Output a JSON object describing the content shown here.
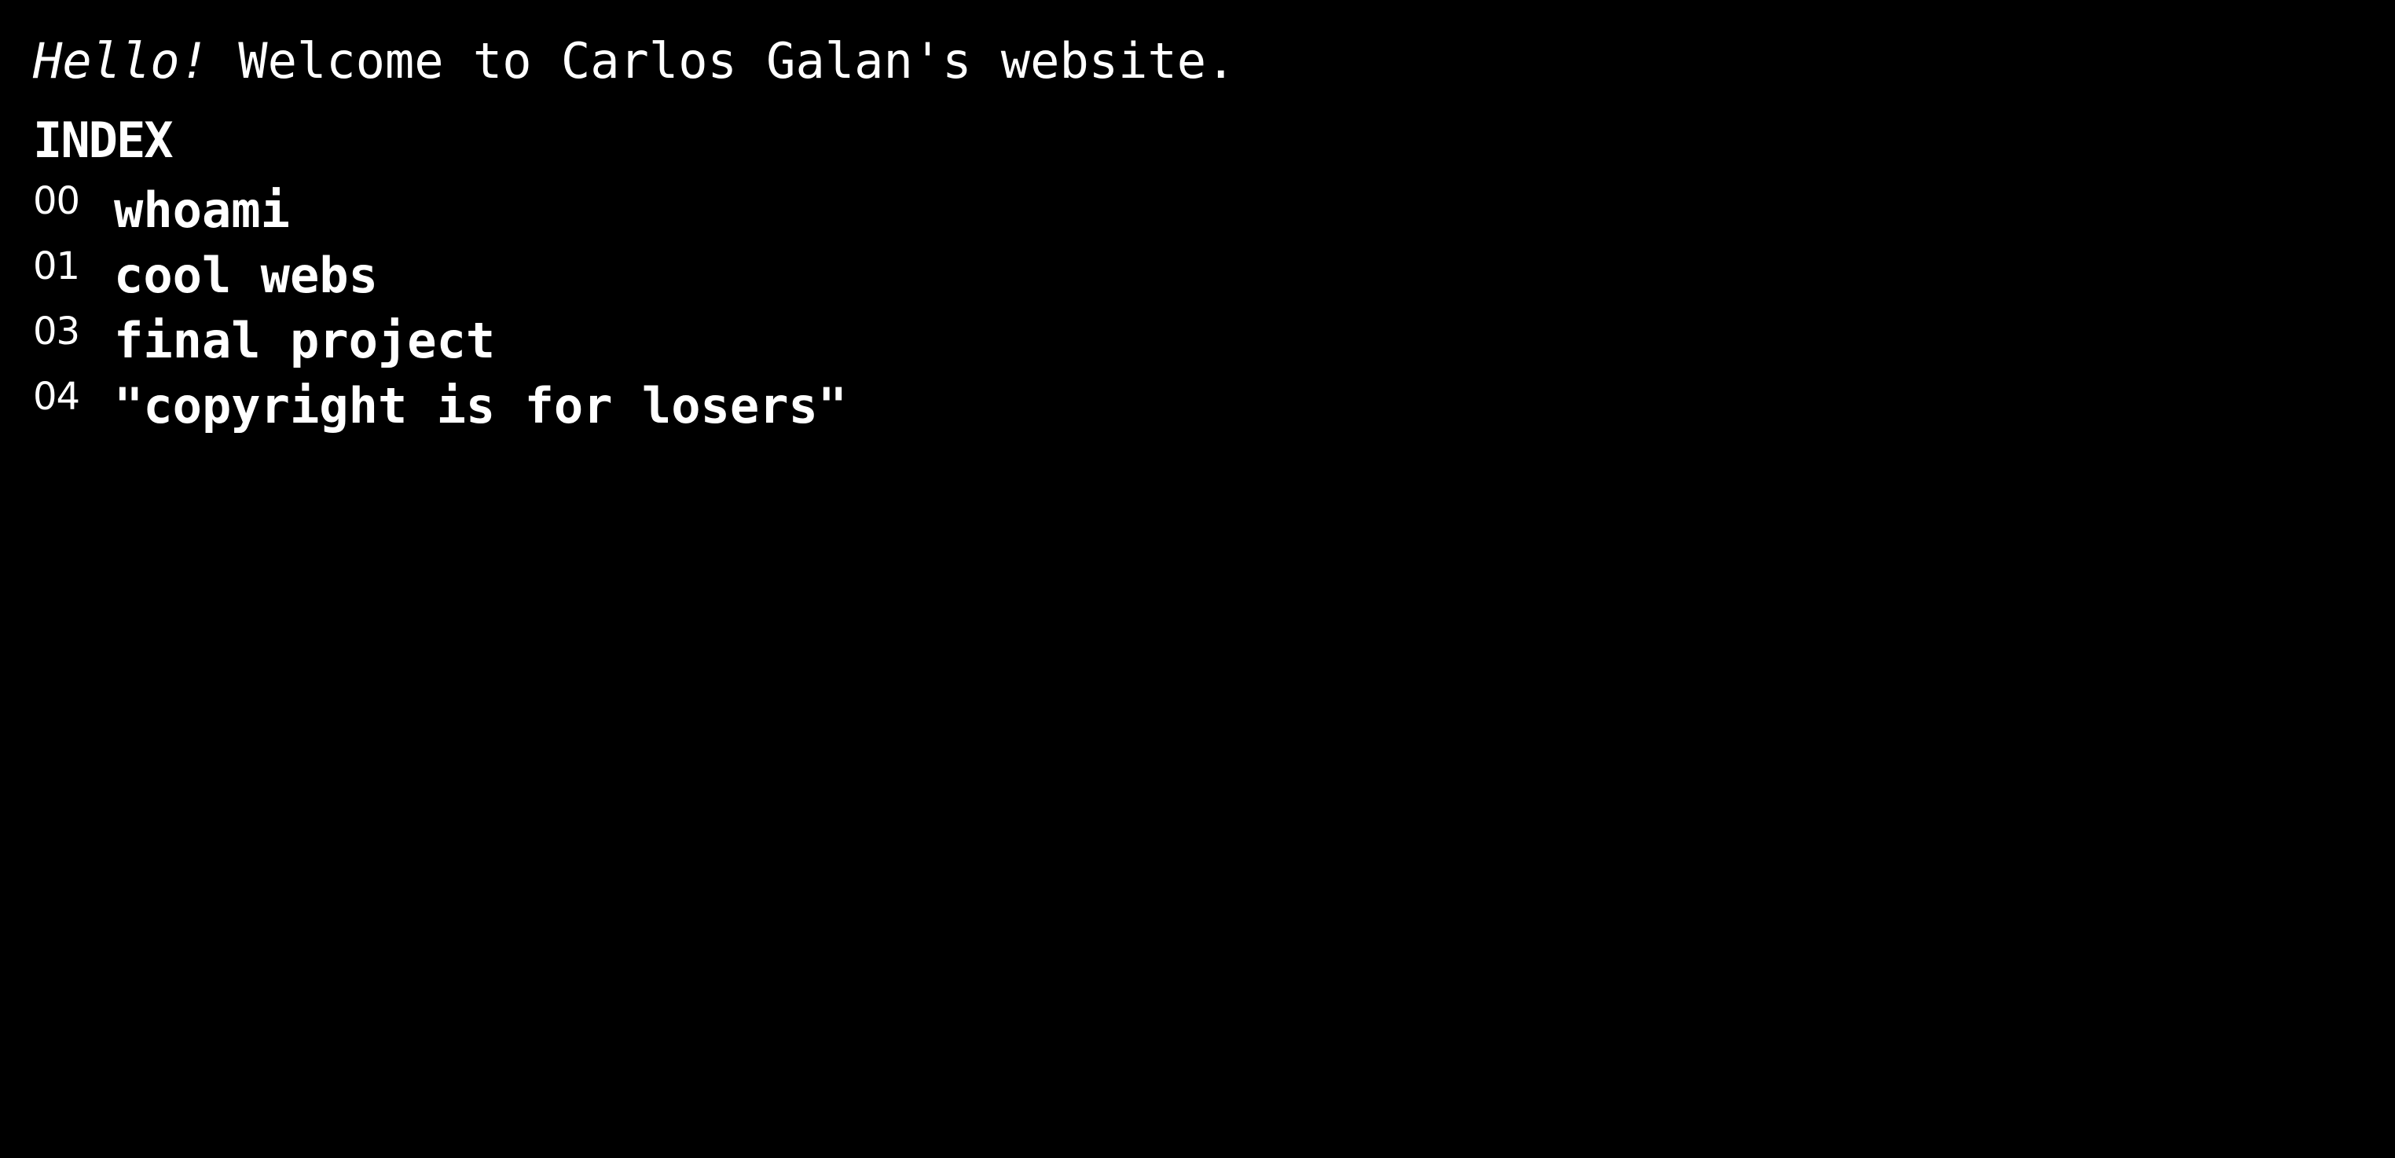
{
  "greeting": {
    "hello": "Hello!",
    "message": "Welcome to Carlos Galan's website."
  },
  "index": {
    "title": "INDEX",
    "items": [
      {
        "number": "00",
        "label": "whoami"
      },
      {
        "number": "01",
        "label": "cool webs"
      },
      {
        "number": "03",
        "label": "final project"
      },
      {
        "number": "04",
        "label": "\"copyright is for losers\""
      }
    ]
  },
  "colors": {
    "background": "#000000",
    "text": "#ffffff"
  }
}
